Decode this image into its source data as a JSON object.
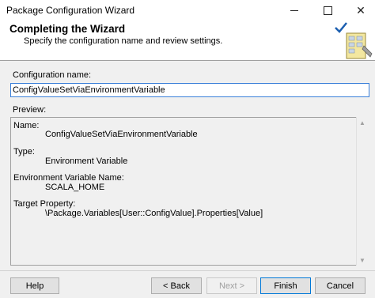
{
  "window": {
    "title": "Package Configuration Wizard",
    "minimize_icon": "minimize-icon",
    "maximize_icon": "maximize-icon",
    "close_glyph": "✕"
  },
  "header": {
    "title": "Completing the Wizard",
    "subtitle": "Specify the configuration name and review settings.",
    "icon": "wizard-checkmark-icon"
  },
  "form": {
    "config_name_label": "Configuration name:",
    "config_name_value": "ConfigValueSetViaEnvironmentVariable",
    "preview_label": "Preview:"
  },
  "preview": {
    "name_label": "Name:",
    "name_value": "ConfigValueSetViaEnvironmentVariable",
    "type_label": "Type:",
    "type_value": "Environment Variable",
    "env_label": "Environment Variable Name:",
    "env_value": "SCALA_HOME",
    "target_label": "Target Property:",
    "target_value": "\\Package.Variables[User::ConfigValue].Properties[Value]"
  },
  "scrollbar": {
    "up_glyph": "▲",
    "down_glyph": "▼"
  },
  "buttons": {
    "help": "Help",
    "back": "< Back",
    "next": "Next >",
    "finish": "Finish",
    "cancel": "Cancel"
  },
  "colors": {
    "accent": "#0078d7",
    "input_border": "#3a7fd9",
    "dialog_bg": "#f0f0f0"
  }
}
